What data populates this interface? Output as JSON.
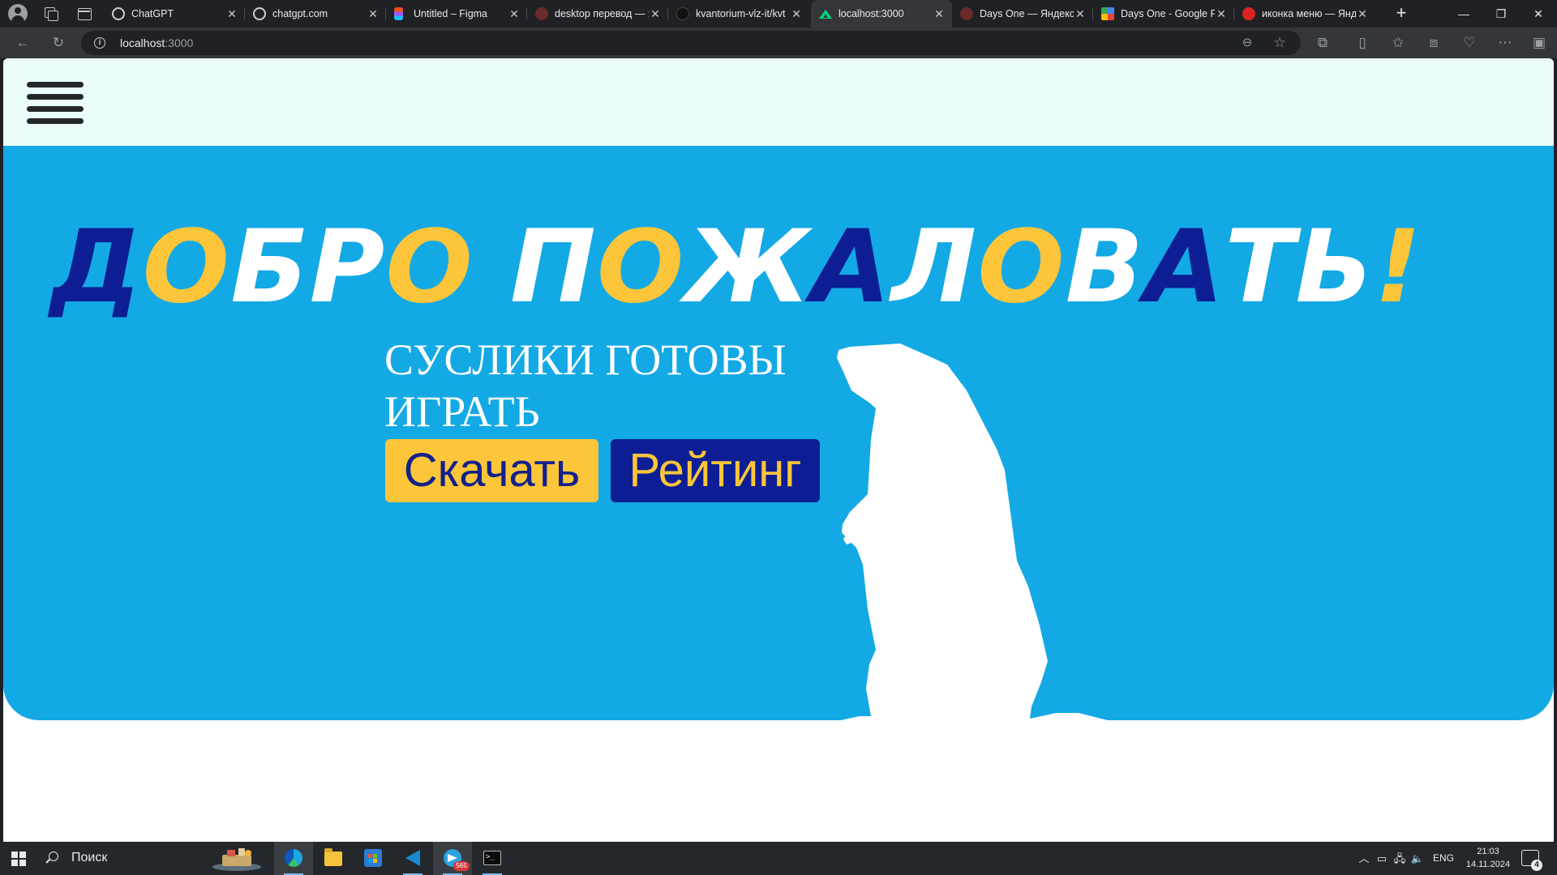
{
  "browser": {
    "tabs": [
      {
        "title": "ChatGPT",
        "icon": "openai-icon"
      },
      {
        "title": "chatgpt.com",
        "icon": "openai-icon"
      },
      {
        "title": "Untitled – Figma",
        "icon": "figma-icon"
      },
      {
        "title": "desktop перевод — Я",
        "icon": "yandex-icon"
      },
      {
        "title": "kvantorium-vlz-it/kvt",
        "icon": "github-icon"
      },
      {
        "title": "localhost:3000",
        "icon": "nuxt-icon",
        "active": true
      },
      {
        "title": "Days One — Яндекс",
        "icon": "yandex-icon"
      },
      {
        "title": "Days One - Google F",
        "icon": "google-fonts-icon"
      },
      {
        "title": "иконка меню — Янд",
        "icon": "yandex-icon"
      }
    ],
    "address": {
      "host": "localhost",
      "port": ":3000"
    }
  },
  "page": {
    "title_words": {
      "w1": {
        "l1": "Д",
        "l2": "О",
        "l3": "Б",
        "l4": "Р",
        "l5": "О"
      },
      "w2": {
        "l1": "П",
        "l2": "О",
        "l3": "Ж",
        "l4": "А",
        "l5": "Л",
        "l6": "О",
        "l7": "В",
        "l8": "А",
        "l9": "Т",
        "l10": "Ь",
        "l11": "!"
      }
    },
    "subtitle_line1": "СУСЛИКИ ГОТОВЫ",
    "subtitle_line2": "ИГРАТЬ",
    "download_label": "Скачать",
    "rating_label": "Рейтинг",
    "colors": {
      "hero_bg": "#13a9e5",
      "navy": "#0d1e94",
      "gold": "#fdc53a",
      "header_bg": "#ebfcfd"
    }
  },
  "taskbar": {
    "search_placeholder": "Поиск",
    "telegram_badge": "565",
    "language": "ENG",
    "time": "21:03",
    "date": "14.11.2024",
    "notifications": "4"
  }
}
